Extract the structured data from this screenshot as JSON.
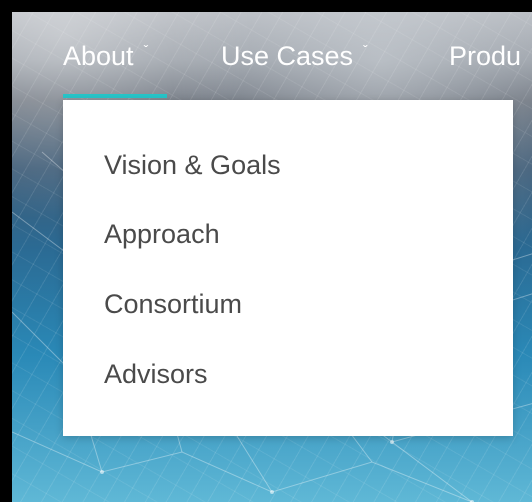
{
  "nav": {
    "items": [
      {
        "label": "About",
        "has_dropdown": true,
        "active": true
      },
      {
        "label": "Use Cases",
        "has_dropdown": true,
        "active": false
      },
      {
        "label": "Produ",
        "has_dropdown": false,
        "active": false
      }
    ],
    "chevron_icon": "chevron-down-icon"
  },
  "dropdown": {
    "items": [
      {
        "label": "Vision & Goals"
      },
      {
        "label": "Approach"
      },
      {
        "label": "Consortium"
      },
      {
        "label": "Advisors"
      }
    ]
  },
  "colors": {
    "accent": "#27c4c8",
    "menu_text": "#4a4a4a",
    "nav_text": "#ffffff",
    "menu_bg": "#ffffff"
  }
}
